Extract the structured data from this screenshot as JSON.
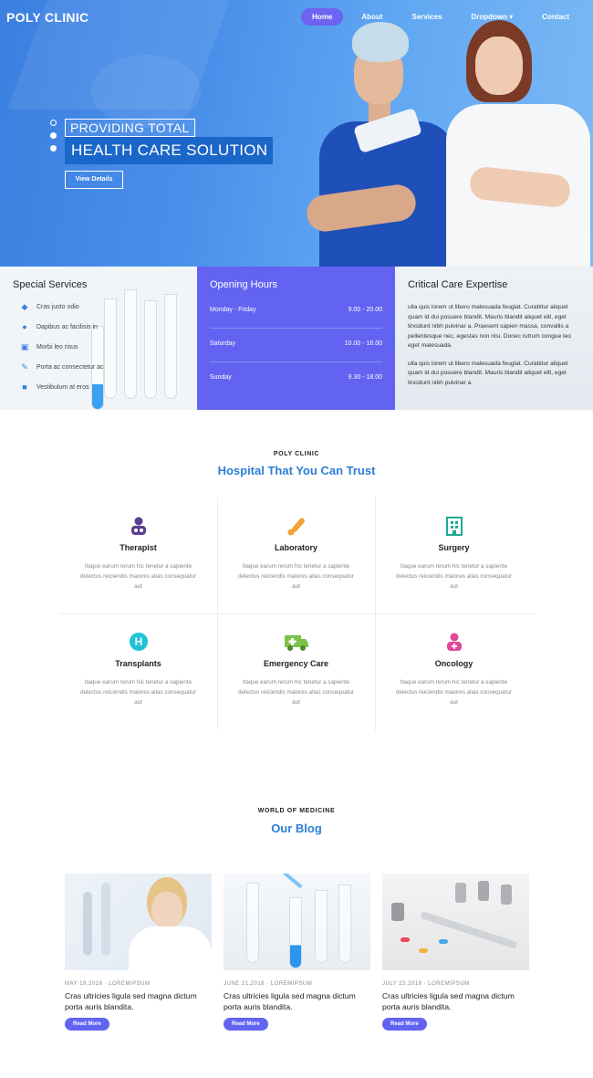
{
  "header": {
    "brand": "POLY CLINIC",
    "nav": [
      "Home",
      "About",
      "Services",
      "Dropdown",
      "Contact"
    ]
  },
  "hero": {
    "line1": "PROVIDING TOTAL",
    "line2": "HEALTH CARE SOLUTION",
    "button": "View Details"
  },
  "special_services": {
    "title": "Special Services",
    "items": [
      {
        "label": "Cras justo odio",
        "icon": "diamond-icon"
      },
      {
        "label": "Dapibus ac facilisis in",
        "icon": "user-icon"
      },
      {
        "label": "Morbi leo risus",
        "icon": "image-icon"
      },
      {
        "label": "Porta ac consectetur ac",
        "icon": "pencil-icon"
      },
      {
        "label": "Vestibulum at eros",
        "icon": "truck-icon"
      }
    ]
  },
  "opening_hours": {
    "title": "Opening Hours",
    "rows": [
      {
        "day": "Monday - Friday",
        "time": "9.00 - 20.00"
      },
      {
        "day": "Saturday",
        "time": "10.00 - 16.00"
      },
      {
        "day": "Sunday",
        "time": "9.30 - 18.00"
      }
    ]
  },
  "expertise": {
    "title": "Critical Care Expertise",
    "p1": "ulla quis lorem ut libero malesuada feugiat. Curabitur aliquet quam id dui posuere blandit. Mauris blandit aliquet elit, eget tincidunt nibh pulvinar a. Praesent sapien massa, convallis a pellentesque nec, egestas non nisi. Donec rutrum congue leo eget malesuada.",
    "p2": "ulla quis lorem ut libero malesuada feugiat. Curabitur aliquet quam id dui posuere blandit. Mauris blandit aliquet elit, eget tincidunt nibh pulvinar a."
  },
  "trust": {
    "kicker": "POLY CLINIC",
    "heading": "Hospital That You Can Trust",
    "services": [
      {
        "title": "Therapist",
        "desc": "Itaque earum rerum hic tenetur a sapiente delectus reiciendis maiores alias consequatur aut",
        "icon": "doctor-icon",
        "color": "#5b3e8f"
      },
      {
        "title": "Laboratory",
        "desc": "Itaque earum rerum hic tenetur a sapiente delectus reiciendis maiores alias consequatur aut",
        "icon": "thermometer-icon",
        "color": "#f0a23a"
      },
      {
        "title": "Surgery",
        "desc": "Itaque earum rerum hic tenetur a sapiente delectus reiciendis maiores alias consequatur aut",
        "icon": "hospital-icon",
        "color": "#20a894"
      },
      {
        "title": "Transplants",
        "desc": "Itaque earum rerum hic tenetur a sapiente delectus reiciendis maiores alias consequatur aut",
        "icon": "h-sign-icon",
        "color": "#1ec4d4"
      },
      {
        "title": "Emergency Care",
        "desc": "Itaque earum rerum hic tenetur a sapiente delectus reiciendis maiores alias consequatur aut",
        "icon": "ambulance-icon",
        "color": "#7bc24a"
      },
      {
        "title": "Oncology",
        "desc": "Itaque earum rerum hic tenetur a sapiente delectus reiciendis maiores alias consequatur aut",
        "icon": "nurse-icon",
        "color": "#e0489a"
      }
    ]
  },
  "blog": {
    "kicker": "WORLD OF MEDICINE",
    "heading": "Our Blog",
    "posts": [
      {
        "meta": "MAY 19,2018 · LOREMIPSUM",
        "title": "Cras ultricies ligula sed magna dictum porta auris blandita.",
        "button": "Read More"
      },
      {
        "meta": "JUNE 21,2018 · LOREMIPSUM",
        "title": "Cras ultricies ligula sed magna dictum porta auris blandita.",
        "button": "Read More"
      },
      {
        "meta": "JULY 23,2018 · LOREMIPSUM",
        "title": "Cras ultricies ligula sed magna dictum porta auris blandita.",
        "button": "Read More"
      }
    ]
  },
  "colors": {
    "accent": "#6264f1",
    "heading_blue": "#2b7fd4",
    "hero_blue": "#4a90ea"
  }
}
